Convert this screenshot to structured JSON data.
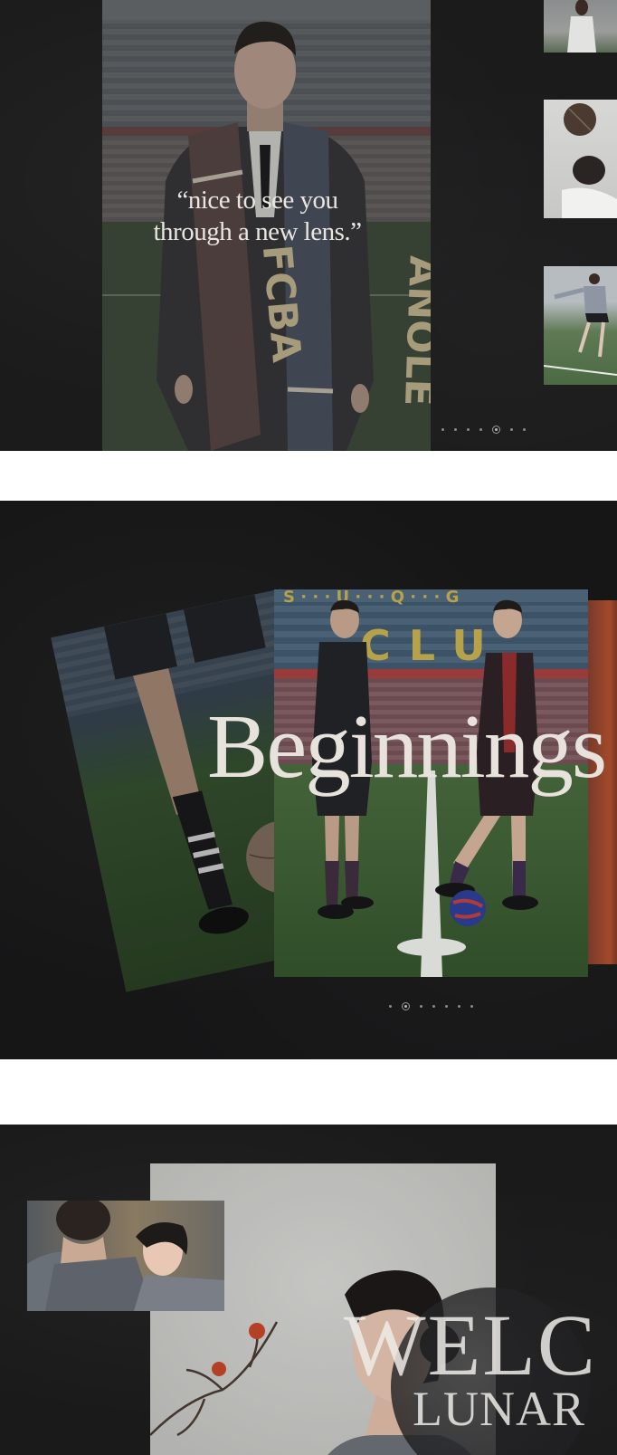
{
  "section_quote": {
    "quote_line1": "“nice to see you",
    "quote_line2": "through a new lens.”",
    "scarf_text_left": "FCBA",
    "scarf_text_right": "ANOLE",
    "carousel_dots": {
      "count": 7,
      "active_index": 4
    }
  },
  "section_beginnings": {
    "heading": "Beginnings",
    "carousel_dots": {
      "count": 7,
      "active_index": 1
    },
    "stand_letters": "CLU"
  },
  "section_lunar": {
    "heading_line1": "WELC",
    "heading_line2": "LUNAR"
  },
  "colors": {
    "panel_bg": "#1b1b1c",
    "page_bg": "#ffffff",
    "title_text": "#e7e3dc"
  }
}
